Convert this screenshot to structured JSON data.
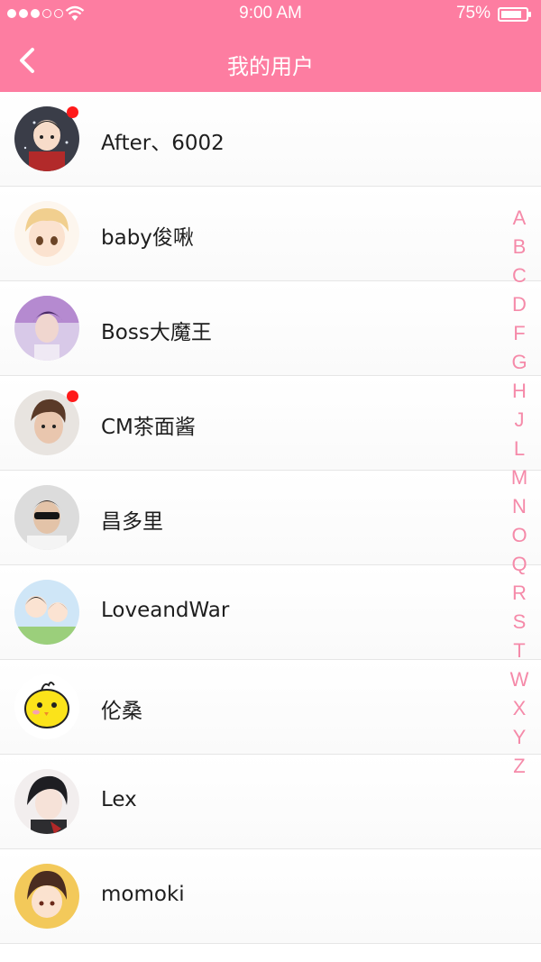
{
  "status_bar": {
    "time": "9:00 AM",
    "battery_percent": "75%",
    "battery_level": 0.75,
    "signal_bars_filled": 3,
    "signal_bars_total": 5
  },
  "header": {
    "title": "我的用户",
    "back_icon": "chevron-left-icon",
    "background_color": "#fd7da1"
  },
  "users": [
    {
      "name": "After、6002",
      "unread": true
    },
    {
      "name": "baby俊啾",
      "unread": false
    },
    {
      "name": "Boss大魔王",
      "unread": false
    },
    {
      "name": "CM茶面酱",
      "unread": true
    },
    {
      "name": "昌多里",
      "unread": false
    },
    {
      "name": "LoveandWar",
      "unread": false
    },
    {
      "name": "伦桑",
      "unread": false
    },
    {
      "name": "Lex",
      "unread": false
    },
    {
      "name": "momoki",
      "unread": false
    }
  ],
  "index_letters": [
    "A",
    "B",
    "C",
    "D",
    "F",
    "G",
    "H",
    "J",
    "L",
    "M",
    "N",
    "O",
    "Q",
    "R",
    "S",
    "T",
    "W",
    "X",
    "Y",
    "Z"
  ],
  "colors": {
    "accent": "#fd7da1",
    "index_letter": "#f58aa9",
    "unread_dot": "#ff1a1a"
  }
}
